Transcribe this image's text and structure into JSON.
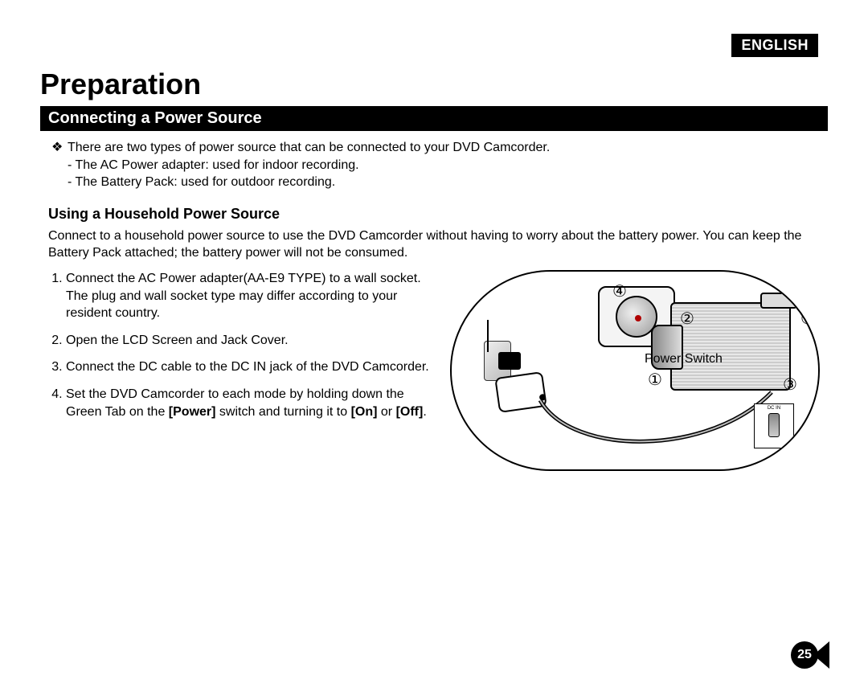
{
  "language_badge": "ENGLISH",
  "chapter_title": "Preparation",
  "section_heading": "Connecting a Power Source",
  "intro_bullet": "There are two types of power source that can be connected to your DVD Camcorder.",
  "intro_sub": {
    "a": "The AC Power adapter: used for indoor recording.",
    "b": "The Battery Pack: used for outdoor recording."
  },
  "sub_heading": "Using a Household Power Source",
  "sub_para": "Connect to a household power source to use the DVD Camcorder without having to worry about the battery power. You can keep the Battery Pack attached; the battery power will not be consumed.",
  "steps": {
    "s1a": "Connect the AC Power adapter(AA-E9 TYPE) to a wall socket.",
    "s1b": "The plug and wall socket type may differ according to your resident country.",
    "s2": "Open the LCD Screen and Jack Cover.",
    "s3": "Connect the DC cable to the DC IN jack of the DVD Camcorder.",
    "s4a": "Set the DVD Camcorder to each mode by holding down the Green Tab on the ",
    "s4b": "[Power]",
    "s4c": " switch and turning it to ",
    "s4d": "[On]",
    "s4e": " or ",
    "s4f": "[Off]",
    "s4g": "."
  },
  "diagram": {
    "callout1": "①",
    "callout2": "②",
    "callout3": "③",
    "callout4": "④",
    "power_switch_label": "Power Switch",
    "dc_in_label": "DC IN"
  },
  "page_number": "25"
}
